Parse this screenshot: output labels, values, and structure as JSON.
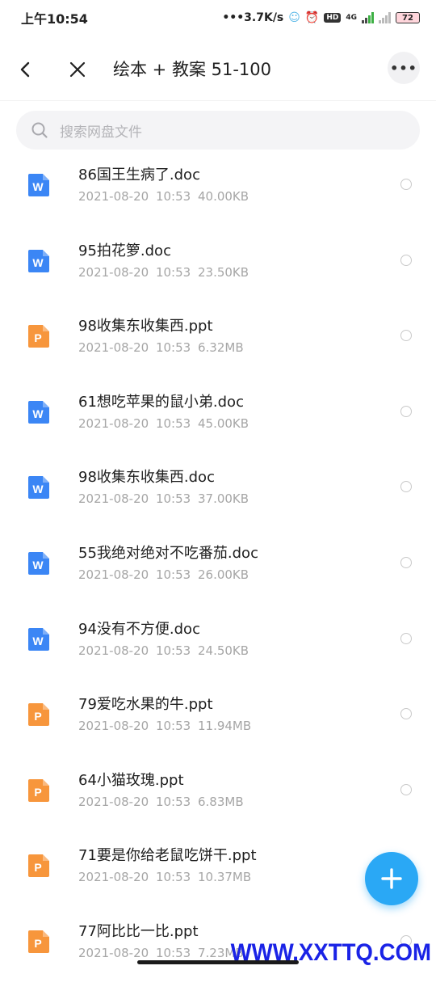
{
  "status_bar": {
    "time": "上午10:54",
    "net_speed": "•••3.7K/s",
    "badge_hd": "HD",
    "net_type": "4G",
    "battery": "72"
  },
  "header": {
    "title": "绘本 + 教案 51-100",
    "more_label": "•••"
  },
  "search": {
    "placeholder": "搜索网盘文件"
  },
  "colors": {
    "doc_icon": "#3b86f5",
    "ppt_icon": "#f7963c",
    "fab": "#2aa8f5",
    "watermark": "#1a23e6"
  },
  "files": [
    {
      "name": "86国王生病了.doc",
      "date": "2021-08-20",
      "time": "10:53",
      "size": "40.00KB",
      "type": "doc",
      "icon_letter": "W"
    },
    {
      "name": "95拍花箩.doc",
      "date": "2021-08-20",
      "time": "10:53",
      "size": "23.50KB",
      "type": "doc",
      "icon_letter": "W"
    },
    {
      "name": "98收集东收集西.ppt",
      "date": "2021-08-20",
      "time": "10:53",
      "size": "6.32MB",
      "type": "ppt",
      "icon_letter": "P"
    },
    {
      "name": "61想吃苹果的鼠小弟.doc",
      "date": "2021-08-20",
      "time": "10:53",
      "size": "45.00KB",
      "type": "doc",
      "icon_letter": "W"
    },
    {
      "name": "98收集东收集西.doc",
      "date": "2021-08-20",
      "time": "10:53",
      "size": "37.00KB",
      "type": "doc",
      "icon_letter": "W"
    },
    {
      "name": "55我绝对绝对不吃番茄.doc",
      "date": "2021-08-20",
      "time": "10:53",
      "size": "26.00KB",
      "type": "doc",
      "icon_letter": "W"
    },
    {
      "name": "94没有不方便.doc",
      "date": "2021-08-20",
      "time": "10:53",
      "size": "24.50KB",
      "type": "doc",
      "icon_letter": "W"
    },
    {
      "name": "79爱吃水果的牛.ppt",
      "date": "2021-08-20",
      "time": "10:53",
      "size": "11.94MB",
      "type": "ppt",
      "icon_letter": "P"
    },
    {
      "name": "64小猫玫瑰.ppt",
      "date": "2021-08-20",
      "time": "10:53",
      "size": "6.83MB",
      "type": "ppt",
      "icon_letter": "P"
    },
    {
      "name": "71要是你给老鼠吃饼干.ppt",
      "date": "2021-08-20",
      "time": "10:53",
      "size": "10.37MB",
      "type": "ppt",
      "icon_letter": "P"
    },
    {
      "name": "77阿比比一比.ppt",
      "date": "2021-08-20",
      "time": "10:53",
      "size": "7.23MB",
      "type": "ppt",
      "icon_letter": "P"
    }
  ],
  "watermark": "WWW.XXTTQ.COM"
}
